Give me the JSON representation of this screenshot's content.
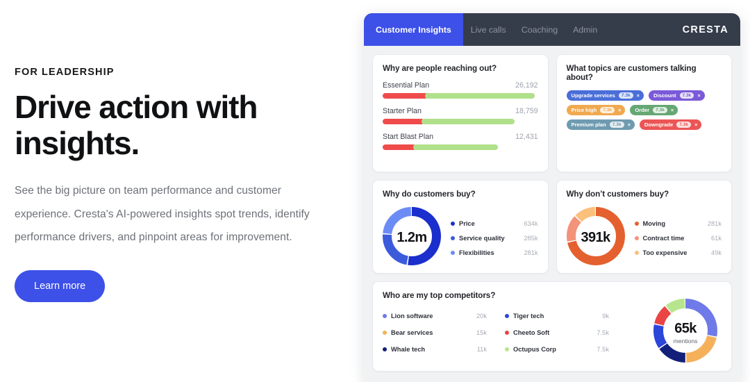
{
  "marketing": {
    "eyebrow": "FOR LEADERSHIP",
    "headline": "Drive action with insights.",
    "subcopy": "See the big picture on team performance and customer experience. Cresta's AI-powered insights spot trends, identify performance drivers, and pinpoint areas for improvement.",
    "cta_label": "Learn more",
    "cta_color": "#3d50e8"
  },
  "dashboard": {
    "brand": "CRESTA",
    "tabs": [
      {
        "label": "Customer Insights",
        "active": true
      },
      {
        "label": "Live calls",
        "active": false
      },
      {
        "label": "Coaching",
        "active": false
      },
      {
        "label": "Admin",
        "active": false
      }
    ],
    "active_tab_color": "#3d50e8",
    "topbar_color": "#353c4a",
    "cards": {
      "reaching_out": {
        "title": "Why are people reaching out?",
        "rows": [
          {
            "label": "Essential Plan",
            "value": "26,192",
            "seg_a_pct": 29,
            "seg_b_pct": 71,
            "track_pct": 100
          },
          {
            "label": "Starter Plan",
            "value": "18,759",
            "seg_a_pct": 31,
            "seg_b_pct": 69,
            "track_pct": 87
          },
          {
            "label": "Start Blast Plan",
            "value": "12,431",
            "seg_a_pct": 28,
            "seg_b_pct": 72,
            "track_pct": 76
          }
        ],
        "seg_a_color": "#ef4b4b",
        "seg_b_color": "#b0e08a"
      },
      "topics": {
        "title": "What topics are customers talking about?",
        "chips": [
          {
            "label": "Upgrade services",
            "count": "7.3k",
            "remove": "×",
            "color": "#4a6ed8"
          },
          {
            "label": "Discount",
            "count": "7.3k",
            "remove": "×",
            "color": "#7a5ad8"
          },
          {
            "label": "Price high",
            "count": "7.3k",
            "remove": "×",
            "color": "#f0a košice"
          },
          {
            "label": "Order",
            "count": "7.3k",
            "remove": "×",
            "color": "#66a773"
          },
          {
            "label": "Premium plan",
            "count": "7.3k",
            "remove": "×",
            "color": "#6f9bb0"
          },
          {
            "label": "Downgrade",
            "count": "7.3k",
            "remove": "×",
            "color": "#ec5555"
          }
        ]
      },
      "why_buy": {
        "title": "Why do customers buy?",
        "center_value": "1.2m",
        "legend": [
          {
            "label": "Price",
            "value": "634k",
            "color": "#1b2fcc"
          },
          {
            "label": "Service quality",
            "value": "285k",
            "color": "#3b5bdb"
          },
          {
            "label": "Flexibilities",
            "value": "281k",
            "color": "#6c8cf5"
          }
        ]
      },
      "why_not_buy": {
        "title": "Why don’t customers buy?",
        "center_value": "391k",
        "legend": [
          {
            "label": "Moving",
            "value": "281k",
            "color": "#e4602f"
          },
          {
            "label": "Contract time",
            "value": "61k",
            "color": "#f2937a"
          },
          {
            "label": "Too expensive",
            "value": "49k",
            "color": "#fbc07c"
          }
        ]
      },
      "competitors": {
        "title": "Who are my top competitors?",
        "center_value": "65k",
        "center_sub": "mentions",
        "col1": [
          {
            "label": "Lion software",
            "value": "20k",
            "color": "#6f7ae8"
          },
          {
            "label": "Bear services",
            "value": "15k",
            "color": "#f5b15a"
          },
          {
            "label": "Whale tech",
            "value": "11k",
            "color": "#13207a"
          }
        ],
        "col2": [
          {
            "label": "Tiger tech",
            "value": "9k",
            "color": "#2b46d8"
          },
          {
            "label": "Cheeto Soft",
            "value": "7.5k",
            "color": "#ea4444"
          },
          {
            "label": "Octupus Corp",
            "value": "7.5k",
            "color": "#b7e58e"
          }
        ]
      }
    }
  },
  "chart_data": [
    {
      "type": "bar",
      "title": "Why are people reaching out?",
      "categories": [
        "Essential Plan",
        "Starter Plan",
        "Start Blast Plan"
      ],
      "values": [
        26192,
        18759,
        12431
      ],
      "value_labels": [
        "26,192",
        "18,759",
        "12,431"
      ],
      "stacked_split_pct": [
        [
          29,
          71
        ],
        [
          31,
          69
        ],
        [
          28,
          72
        ]
      ],
      "series": [
        {
          "name": "segment-a",
          "color": "#ef4b4b",
          "values": [
            7596,
            5815,
            3481
          ]
        },
        {
          "name": "segment-b",
          "color": "#b0e08a",
          "values": [
            18596,
            12944,
            8950
          ]
        }
      ],
      "xlabel": "",
      "ylabel": "",
      "grid": false,
      "legend": "none"
    },
    {
      "type": "pie",
      "title": "Why do customers buy?",
      "center_label": "1.2m",
      "categories": [
        "Price",
        "Service quality",
        "Flexibilities"
      ],
      "values": [
        634,
        285,
        281
      ],
      "value_labels": [
        "634k",
        "285k",
        "281k"
      ],
      "colors": [
        "#1b2fcc",
        "#3b5bdb",
        "#6c8cf5"
      ],
      "legend": "right"
    },
    {
      "type": "pie",
      "title": "Why don’t customers buy?",
      "center_label": "391k",
      "categories": [
        "Moving",
        "Contract time",
        "Too expensive"
      ],
      "values": [
        281,
        61,
        49
      ],
      "value_labels": [
        "281k",
        "61k",
        "49k"
      ],
      "colors": [
        "#e4602f",
        "#f2937a",
        "#fbc07c"
      ],
      "legend": "right"
    },
    {
      "type": "pie",
      "title": "Who are my top competitors?",
      "center_label": "65k",
      "center_sublabel": "mentions",
      "categories": [
        "Lion software",
        "Bear services",
        "Whale tech",
        "Tiger tech",
        "Cheeto Soft",
        "Octupus Corp"
      ],
      "values": [
        20,
        15,
        11,
        9,
        7.5,
        7.5
      ],
      "value_labels": [
        "20k",
        "15k",
        "11k",
        "9k",
        "7.5k",
        "7.5k"
      ],
      "colors": [
        "#6f7ae8",
        "#f5b15a",
        "#13207a",
        "#2b46d8",
        "#ea4444",
        "#b7e58e"
      ],
      "legend": "left"
    }
  ]
}
